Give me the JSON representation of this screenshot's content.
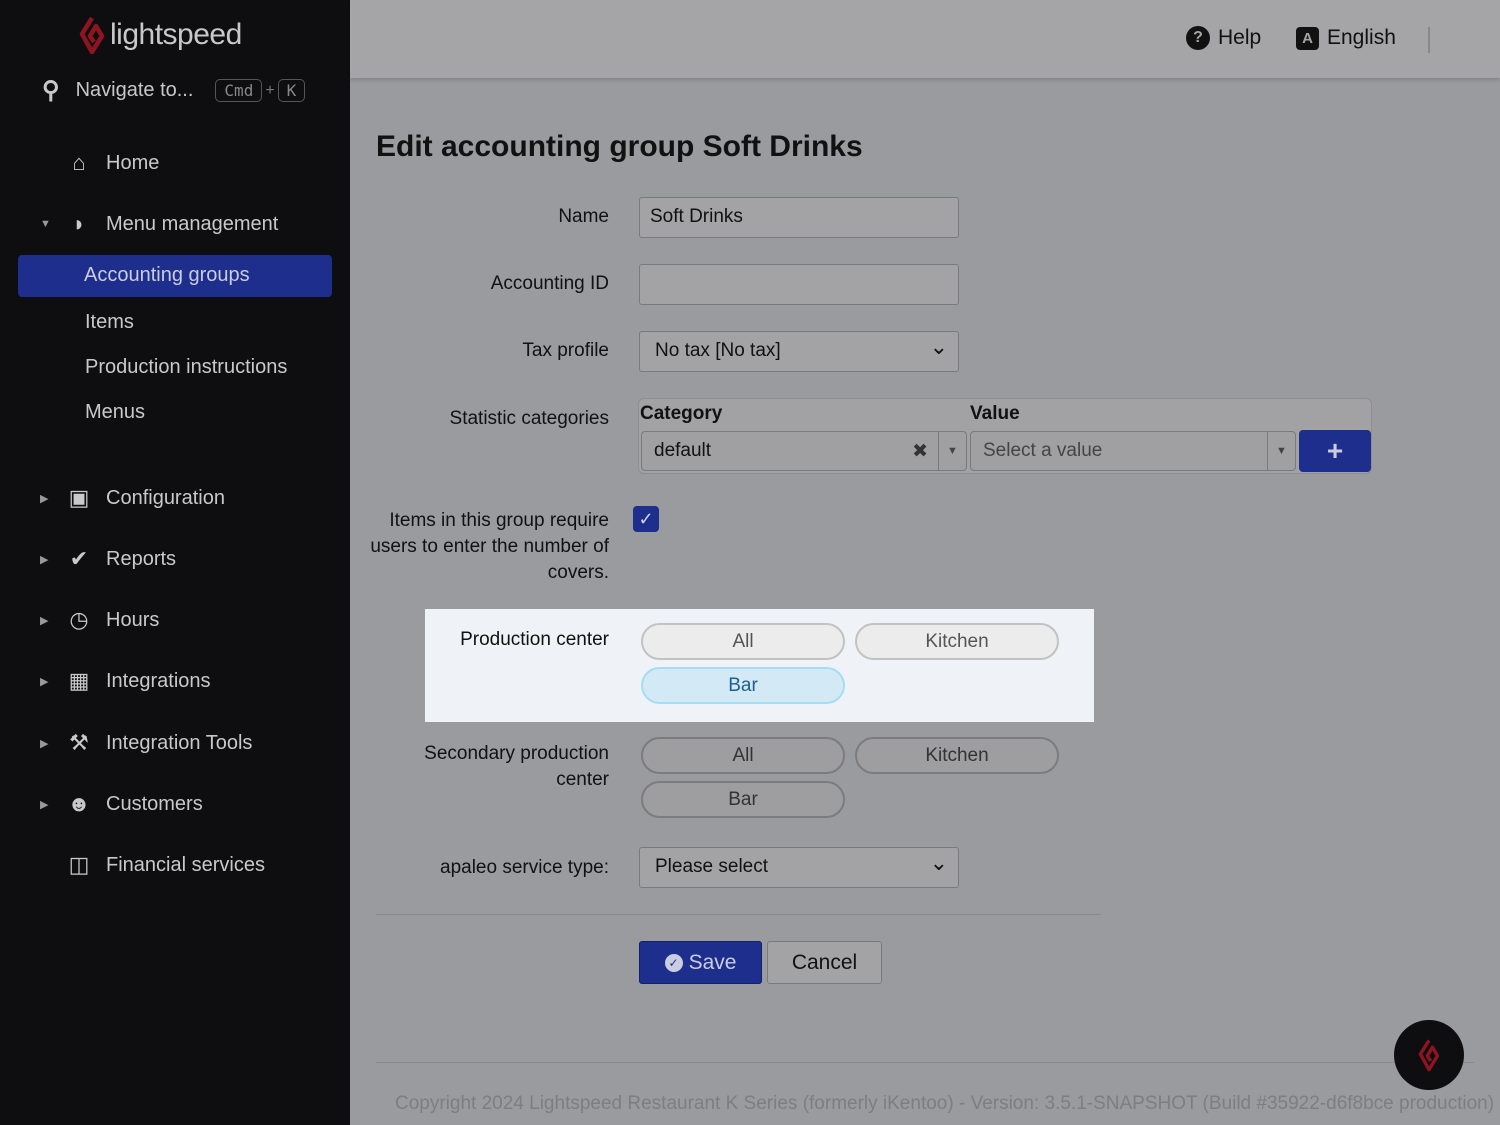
{
  "brand": {
    "name": "lightspeed",
    "accent": "#c8102e"
  },
  "sidebar": {
    "search_label": "Navigate to...",
    "shortcut_key1": "Cmd",
    "shortcut_plus": "+",
    "shortcut_key2": "K",
    "home": "Home",
    "menu_management": "Menu management",
    "sub_items": [
      "Accounting groups",
      "Items",
      "Production instructions",
      "Menus"
    ],
    "sections": [
      {
        "label": "Configuration",
        "icon": "grid-check-icon"
      },
      {
        "label": "Reports",
        "icon": "chart-icon"
      },
      {
        "label": "Hours",
        "icon": "clock-icon"
      },
      {
        "label": "Integrations",
        "icon": "grid-plus-icon"
      },
      {
        "label": "Integration Tools",
        "icon": "hammer-icon"
      },
      {
        "label": "Customers",
        "icon": "user-icon"
      },
      {
        "label": "Financial services",
        "icon": "cash-register-icon"
      }
    ]
  },
  "topbar": {
    "help": "Help",
    "language": "English"
  },
  "form": {
    "title": "Edit accounting group Soft Drinks",
    "name_label": "Name",
    "name_value": "Soft Drinks",
    "accounting_id_label": "Accounting ID",
    "accounting_id_value": "",
    "tax_label": "Tax profile",
    "tax_value": "No tax [No tax]",
    "stat_label": "Statistic categories",
    "stat_category_header": "Category",
    "stat_value_header": "Value",
    "stat_category_value": "default",
    "stat_value_placeholder": "Select a value",
    "covers_label": "Items in this group require users to enter the number of covers.",
    "covers_checked": true,
    "production_label": "Production center",
    "production_options": [
      "All",
      "Kitchen",
      "Bar"
    ],
    "production_selected": "Bar",
    "secondary_label_1": "Secondary production",
    "secondary_label_2": "center",
    "secondary_options": [
      "All",
      "Kitchen",
      "Bar"
    ],
    "apaleo_label": "apaleo service type:",
    "apaleo_value": "Please select",
    "save": "Save",
    "cancel": "Cancel"
  },
  "footer": "Copyright 2024 Lightspeed Restaurant K Series (formerly iKentoo) - Version: 3.5.1-SNAPSHOT (Build #35922-d6f8bce production)"
}
